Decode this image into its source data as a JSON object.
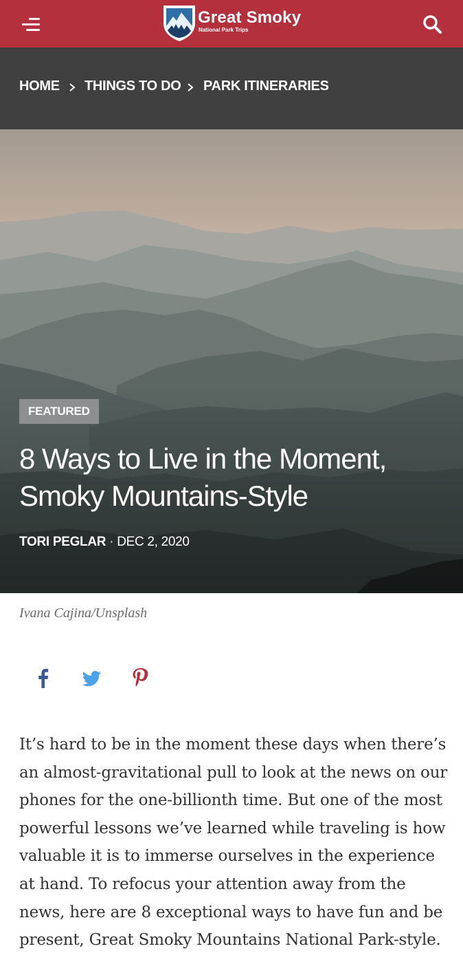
{
  "colors": {
    "header_bg": "#b5303d",
    "breadcrumb_bg": "#404041",
    "badge_bg": "#8e8f90",
    "facebook": "#3b5998",
    "twitter": "#4aa3ea",
    "pinterest": "#b5303d"
  },
  "header": {
    "menu_icon": "hamburger-menu-icon",
    "logo_icon": "mountain-shield-logo",
    "logo_title": "Great Smoky",
    "logo_subtitle": "National Park Trips",
    "search_icon": "search-icon"
  },
  "breadcrumb": {
    "items": [
      "HOME",
      "THINGS TO DO",
      "PARK ITINERARIES"
    ],
    "separator_icon": "chevron-right-icon"
  },
  "hero": {
    "image": "misty-smoky-mountain-ridges-photo",
    "badge": "FEATURED",
    "title": "8 Ways to Live in the Moment, Smoky Mountains-Style",
    "author": "TORI PEGLAR",
    "separator": "·",
    "date": "DEC 2, 2020"
  },
  "photo_credit": "Ivana Cajina/Unsplash",
  "share": {
    "icons": [
      "facebook-icon",
      "twitter-icon",
      "pinterest-icon"
    ]
  },
  "article": {
    "intro": "It’s hard to be in the moment these days when there’s an almost-gravitational pull to look at the news on our phones for the one-billionth time. But one of the most powerful lessons we’ve learned while traveling is how valuable it is to immerse ourselves in the experience at hand. To refocus your attention away from the news, here are 8 exceptional ways to have fun and be present, Great Smoky Mountains National Park-style."
  }
}
